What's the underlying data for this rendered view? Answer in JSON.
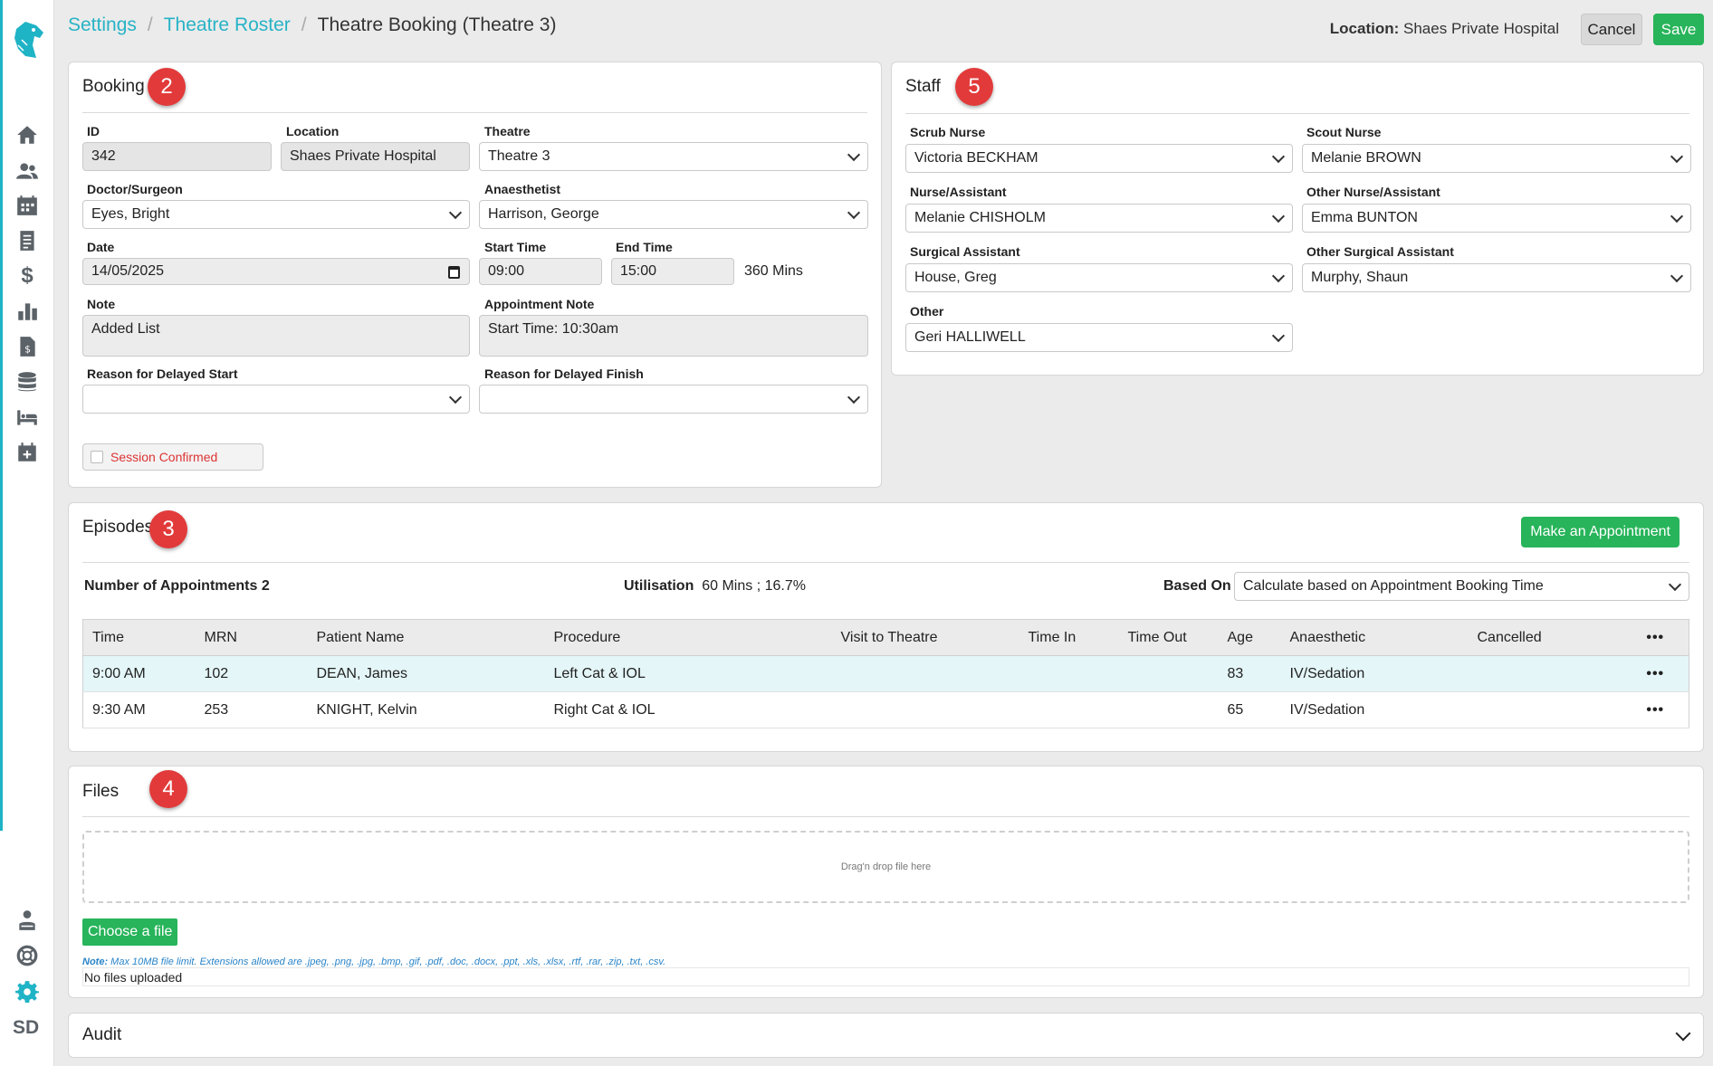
{
  "breadcrumb": {
    "settings": "Settings",
    "roster": "Theatre Roster",
    "current": "Theatre Booking (Theatre 3)"
  },
  "header": {
    "location_label": "Location:",
    "location_value": "Shaes Private Hospital",
    "cancel": "Cancel",
    "save": "Save"
  },
  "sidebar": {
    "initials": "SD",
    "icons": [
      "home-icon",
      "users-icon",
      "calendar-icon",
      "document-icon",
      "dollar-icon",
      "bar-chart-icon",
      "invoice-icon",
      "database-icon",
      "bed-icon",
      "calendar-plus-icon",
      "admin-icon",
      "support-icon",
      "gear-icon"
    ]
  },
  "booking": {
    "title": "Booking",
    "badge": "2",
    "id_label": "ID",
    "id_value": "342",
    "location_label": "Location",
    "location_value": "Shaes Private Hospital",
    "theatre_label": "Theatre",
    "theatre_value": "Theatre 3",
    "doctor_label": "Doctor/Surgeon",
    "doctor_value": "Eyes, Bright",
    "anaesthetist_label": "Anaesthetist",
    "anaesthetist_value": "Harrison, George",
    "date_label": "Date",
    "date_value": "14/05/2025",
    "start_label": "Start Time",
    "start_value": "09:00",
    "end_label": "End Time",
    "end_value": "15:00",
    "duration": "360 Mins",
    "note_label": "Note",
    "note_value": "Added List",
    "appt_note_label": "Appointment Note",
    "appt_note_value": "Start Time: 10:30am",
    "delay_start_label": "Reason for Delayed Start",
    "delay_start_value": "",
    "delay_finish_label": "Reason for Delayed Finish",
    "delay_finish_value": "",
    "session_confirmed": "Session Confirmed"
  },
  "staff": {
    "title": "Staff",
    "badge": "5",
    "scrub_label": "Scrub Nurse",
    "scrub_value": "Victoria BECKHAM",
    "scout_label": "Scout Nurse",
    "scout_value": "Melanie BROWN",
    "nurse_label": "Nurse/Assistant",
    "nurse_value": "Melanie CHISHOLM",
    "other_nurse_label": "Other Nurse/Assistant",
    "other_nurse_value": "Emma BUNTON",
    "surg_label": "Surgical Assistant",
    "surg_value": "House, Greg",
    "other_surg_label": "Other Surgical Assistant",
    "other_surg_value": "Murphy, Shaun",
    "other_label": "Other",
    "other_value": "Geri HALLIWELL"
  },
  "episodes": {
    "title": "Episodes",
    "badge": "3",
    "make_appointment": "Make an Appointment",
    "num_label": "Number of Appointments",
    "num_value": "2",
    "util_label": "Utilisation",
    "util_value": "60 Mins ; 16.7%",
    "based_label": "Based On",
    "based_value": "Calculate based on Appointment Booking Time",
    "columns": [
      "Time",
      "MRN",
      "Patient Name",
      "Procedure",
      "Visit to Theatre",
      "Time In",
      "Time Out",
      "Age",
      "Anaesthetic",
      "Cancelled",
      "•••"
    ],
    "rows": [
      [
        "9:00 AM",
        "102",
        "DEAN, James",
        "Left Cat & IOL",
        "",
        "",
        "",
        "83",
        "IV/Sedation",
        "",
        "•••"
      ],
      [
        "9:30 AM",
        "253",
        "KNIGHT, Kelvin",
        "Right Cat & IOL",
        "",
        "",
        "",
        "65",
        "IV/Sedation",
        "",
        "•••"
      ]
    ]
  },
  "files": {
    "title": "Files",
    "badge": "4",
    "drop_text": "Drag'n drop file here",
    "choose": "Choose a file",
    "note_label": "Note:",
    "note_text": " Max 10MB file limit. Extensions allowed are .jpeg, .png, .jpg, .bmp, .gif, .pdf, .doc, .docx, .ppt, .xls, .xlsx, .rtf, .rar, .zip, .txt, .csv.",
    "none": "No files uploaded"
  },
  "audit": {
    "title": "Audit"
  }
}
